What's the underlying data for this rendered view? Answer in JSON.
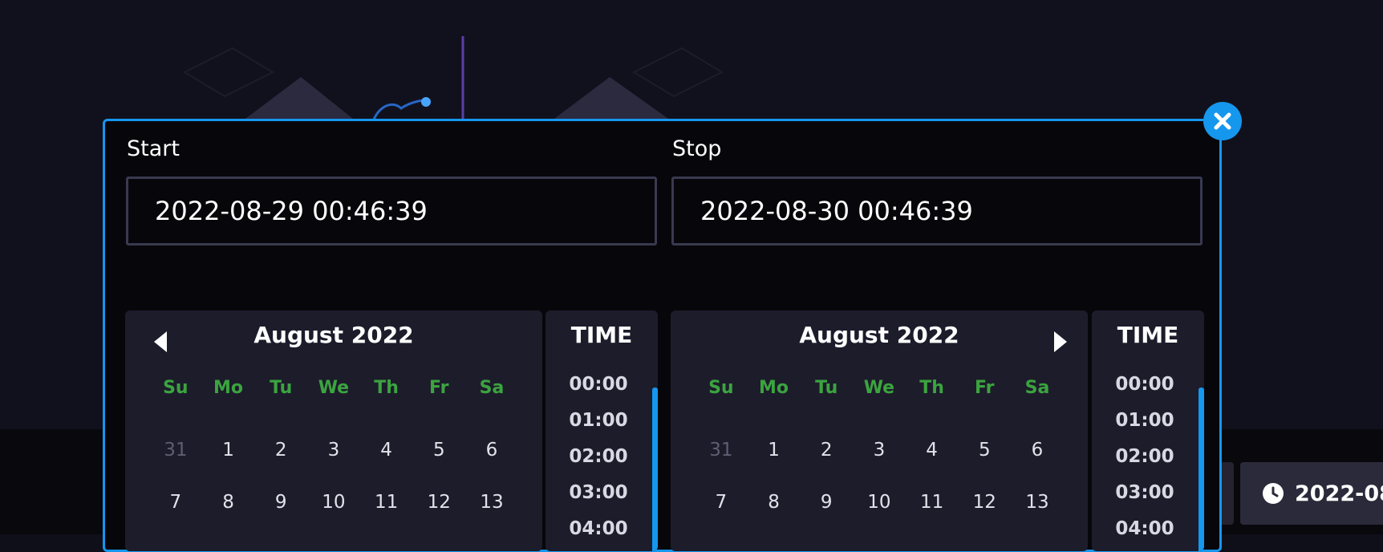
{
  "start": {
    "label": "Start",
    "value": "2022-08-29 00:46:39"
  },
  "stop": {
    "label": "Stop",
    "value": "2022-08-30 00:46:39"
  },
  "calendar_left": {
    "title": "August 2022",
    "weekdays": [
      "Su",
      "Mo",
      "Tu",
      "We",
      "Th",
      "Fr",
      "Sa"
    ],
    "week1": [
      "31",
      "1",
      "2",
      "3",
      "4",
      "5",
      "6"
    ],
    "week2": [
      "7",
      "8",
      "9",
      "10",
      "11",
      "12",
      "13"
    ]
  },
  "calendar_right": {
    "title": "August 2022",
    "weekdays": [
      "Su",
      "Mo",
      "Tu",
      "We",
      "Th",
      "Fr",
      "Sa"
    ],
    "week1": [
      "31",
      "1",
      "2",
      "3",
      "4",
      "5",
      "6"
    ],
    "week2": [
      "7",
      "8",
      "9",
      "10",
      "11",
      "12",
      "13"
    ]
  },
  "time_left": {
    "title": "TIME",
    "options": [
      "00:00",
      "01:00",
      "02:00",
      "03:00",
      "04:00"
    ]
  },
  "time_right": {
    "title": "TIME",
    "options": [
      "00:00",
      "01:00",
      "02:00",
      "03:00",
      "04:00"
    ]
  },
  "time_range_pill": {
    "text": "2022-08"
  },
  "icons": {
    "close": "close-icon",
    "prev": "chevron-left-icon",
    "next": "chevron-right-icon",
    "clock": "clock-icon"
  },
  "colors": {
    "accent": "#1597ee",
    "weekday": "#3ba43f",
    "panel": "#1d1c2b"
  }
}
